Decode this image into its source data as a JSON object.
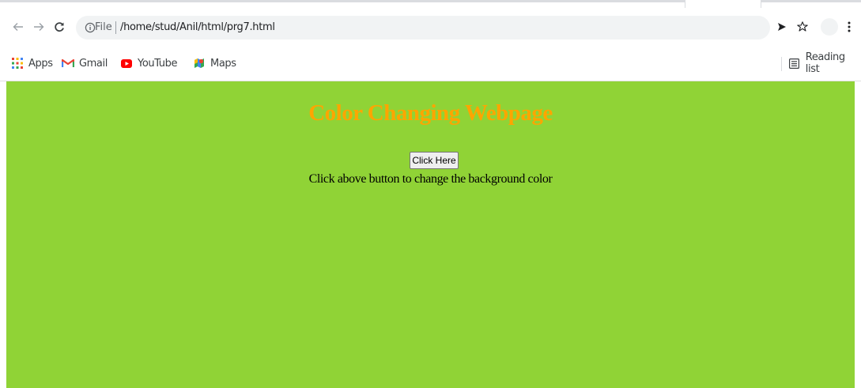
{
  "toolbar": {
    "url_scheme_label": "File",
    "url": "/home/stud/Anil/html/prg7.html"
  },
  "bookmarks": {
    "items": [
      {
        "label": "Apps",
        "icon": "apps-grid-icon"
      },
      {
        "label": "Gmail",
        "icon": "gmail-icon"
      },
      {
        "label": "YouTube",
        "icon": "youtube-icon"
      },
      {
        "label": "Maps",
        "icon": "maps-icon"
      }
    ],
    "reading_list": "Reading list"
  },
  "page": {
    "heading": "Color Changing Webpage",
    "button_label": "Click Here",
    "message": "Click above button to change the background color",
    "colors": {
      "background": "#90d336",
      "heading": "#ffa500"
    }
  }
}
